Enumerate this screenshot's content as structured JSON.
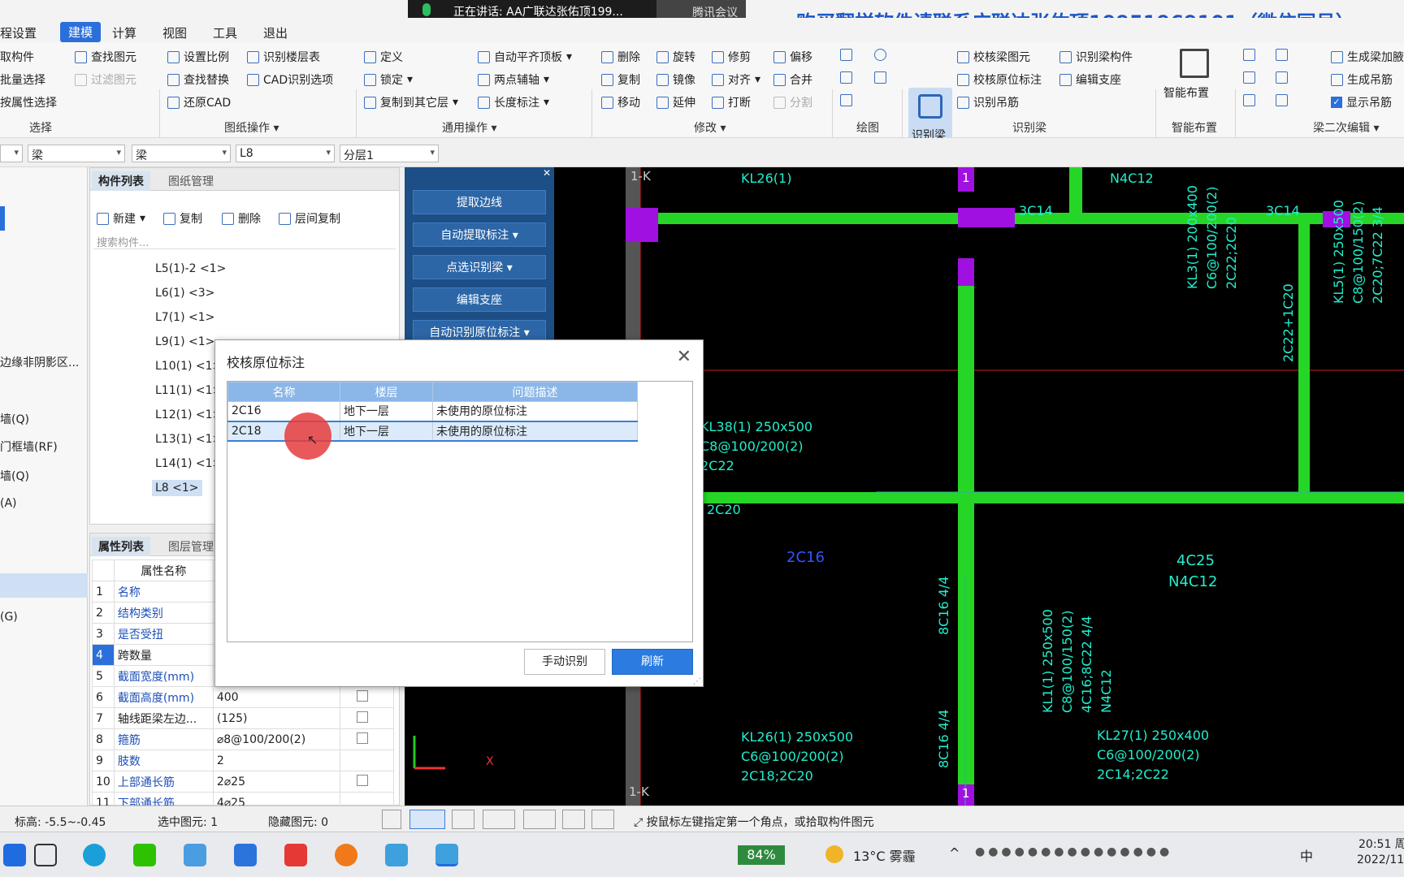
{
  "banner": "购买翻样软件请联系广联达张佑顶19951969101（微信同号）",
  "meeting": {
    "speaking": "正在讲话: AA广联达张佑顶199...",
    "app": "腾讯会议"
  },
  "menu": {
    "items": [
      "程设置",
      "建模",
      "计算",
      "视图",
      "工具",
      "退出"
    ],
    "active": "建模"
  },
  "ribbon": {
    "select": {
      "items": [
        "取构件",
        "批量选择",
        "按属性选择"
      ],
      "group": "选择"
    },
    "find": {
      "items": [
        "查找图元",
        "过滤图元"
      ]
    },
    "drawing_ops": {
      "items": [
        "设置比例",
        "查找替换",
        "还原CAD",
        "识别楼层表",
        "CAD识别选项"
      ],
      "group": "图纸操作"
    },
    "general_ops": {
      "items": [
        "定义",
        "锁定",
        "复制到其它层",
        "自动平齐顶板",
        "两点辅轴",
        "长度标注"
      ],
      "group": "通用操作"
    },
    "modify": {
      "items": [
        "删除",
        "旋转",
        "修剪",
        "偏移",
        "复制",
        "镜像",
        "对齐",
        "合并",
        "移动",
        "延伸",
        "打断",
        "分割"
      ],
      "group": "修改"
    },
    "draw": {
      "group": "绘图"
    },
    "recognize": {
      "big": "识别梁",
      "items": [
        "校核梁图元",
        "识别梁构件",
        "校核原位标注",
        "编辑支座",
        "识别吊筋"
      ],
      "group": "识别梁"
    },
    "smart": {
      "big": "智能布置",
      "group": "智能布置"
    },
    "beam2": {
      "items": [
        "生成梁加腋",
        "生成吊筋",
        "显示吊筋"
      ],
      "group": "梁二次编辑"
    }
  },
  "selectors": [
    "梁",
    "梁",
    "L8",
    "分层1"
  ],
  "farleft": [
    "边缘非阴影区...",
    "墙(Q)",
    "门框墙(RF)",
    "墙(Q)",
    "(A)",
    "(G)"
  ],
  "complist": {
    "tabs": [
      "构件列表",
      "图纸管理"
    ],
    "actions": [
      "新建",
      "复制",
      "删除",
      "层间复制"
    ],
    "search_placeholder": "搜索构件...",
    "items": [
      "L5(1)-2 <1>",
      "L6(1) <3>",
      "L7(1) <1>",
      "L9(1) <1>",
      "L10(1) <1>",
      "L11(1) <1>",
      "L12(1) <1>",
      "L13(1) <1>",
      "L14(1) <1>",
      "L8 <1>"
    ],
    "selected": "L8 <1>"
  },
  "proplist": {
    "tabs": [
      "属性列表",
      "图层管理"
    ],
    "header": "属性名称",
    "rows": [
      {
        "n": "1",
        "name": "名称",
        "value": ""
      },
      {
        "n": "2",
        "name": "结构类别",
        "value": ""
      },
      {
        "n": "3",
        "name": "是否受扭",
        "value": ""
      },
      {
        "n": "4",
        "name": "跨数量",
        "value": ""
      },
      {
        "n": "5",
        "name": "截面宽度(mm)",
        "value": ""
      },
      {
        "n": "6",
        "name": "截面高度(mm)",
        "value": "400"
      },
      {
        "n": "7",
        "name": "轴线距梁左边...",
        "value": "(125)"
      },
      {
        "n": "8",
        "name": "箍筋",
        "value": "⌀8@100/200(2)"
      },
      {
        "n": "9",
        "name": "肢数",
        "value": "2"
      },
      {
        "n": "10",
        "name": "上部通长筋",
        "value": "2⌀25"
      },
      {
        "n": "11",
        "name": "下部通长筋",
        "value": "4⌀25"
      }
    ]
  },
  "bluepanel": [
    "提取边线",
    "自动提取标注",
    "点选识别梁",
    "编辑支座",
    "自动识别原位标注"
  ],
  "dialog": {
    "title": "校核原位标注",
    "columns": [
      "名称",
      "楼层",
      "问题描述"
    ],
    "rows": [
      {
        "name": "2C16",
        "floor": "地下一层",
        "desc": "未使用的原位标注"
      },
      {
        "name": "2C18",
        "floor": "地下一层",
        "desc": "未使用的原位标注"
      }
    ],
    "manual_button": "手动识别",
    "refresh_button": "刷新"
  },
  "cad": {
    "labels": [
      "1-K",
      "KL26(1)",
      "N4C12",
      "3C14",
      "3C14",
      "KL38(1) 250x500",
      "C8@100/200(2)",
      "2C22",
      "2C20",
      "2C16",
      "KL3(1) 200x400",
      "C6@100/200(2)",
      "2C22;2C20",
      "2C22+1C20",
      "KL5(1) 250x500",
      "C8@100/150(2)",
      "2C20;7C22 3/4",
      "4C25",
      "N4C12",
      "8C16 4/4",
      "8C16 4/4",
      "KL1(1) 250x500",
      "C8@100/150(2)",
      "4C16;8C22 4/4",
      "N4C12",
      "KL26(1) 250x500",
      "C6@100/200(2)",
      "2C18;2C20",
      "KL27(1) 250x400",
      "C6@100/200(2)",
      "2C14;2C22",
      "1-K",
      "1",
      "1"
    ]
  },
  "status": {
    "elevation": "标高:  -5.5~-0.45",
    "selected": "选中图元: 1",
    "hidden": "隐藏图元: 0",
    "hint": "按鼠标左键指定第一个角点，或拾取构件图元"
  },
  "taskbar": {
    "battery": "84%",
    "weather": "13°C  雾霾",
    "time": "20:51 周",
    "date": "2022/11"
  }
}
